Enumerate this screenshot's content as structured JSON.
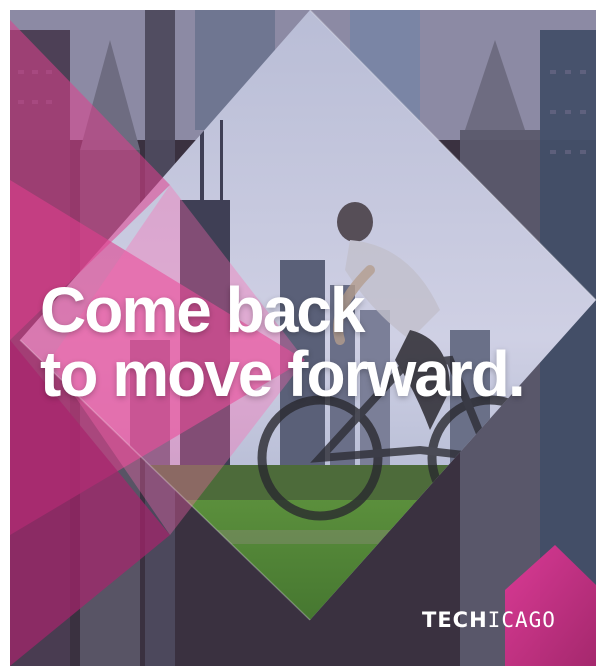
{
  "headline": {
    "line1": "Come back",
    "line2": "to move forward."
  },
  "brand": {
    "logo_bold": "TECH",
    "logo_light": "ICAGO"
  },
  "colors": {
    "accent_pink": "#e0408e",
    "sky": "#c9cde0",
    "grass": "#4f8a3a"
  }
}
